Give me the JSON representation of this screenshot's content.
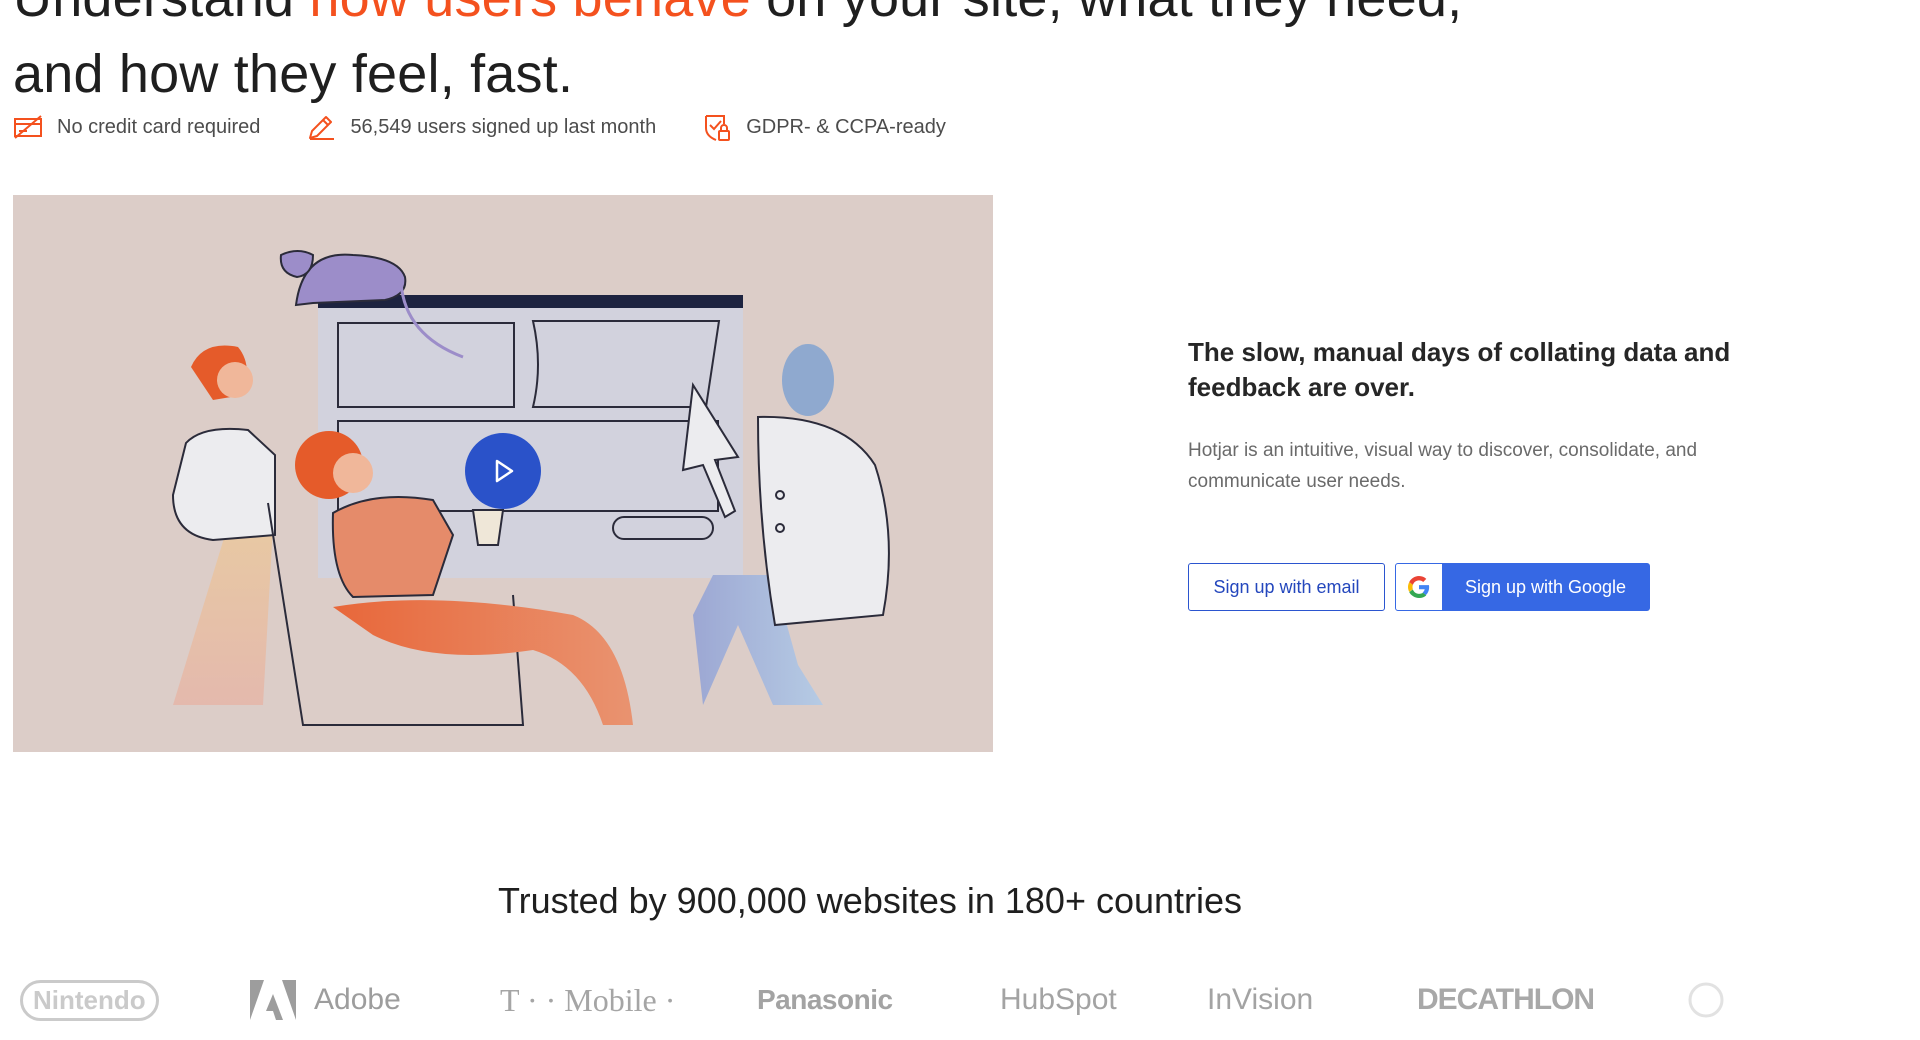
{
  "hero": {
    "title_prefix": "Understand ",
    "title_accent": "how users behave",
    "title_suffix": " on your site, what they need, and how they feel, fast."
  },
  "badges": [
    {
      "icon": "credit-card-icon",
      "label": "No credit card required"
    },
    {
      "icon": "pencil-icon",
      "label": "56,549 users signed up last month"
    },
    {
      "icon": "shield-lock-icon",
      "label": "GDPR- & CCPA-ready"
    }
  ],
  "video": {
    "play_icon": "play-icon"
  },
  "promo": {
    "heading": "The slow, manual days of collating data and feedback are over.",
    "text": "Hotjar is an intuitive, visual way to discover, consolidate, and communicate user needs.",
    "email_button": "Sign up with email",
    "google_button": "Sign up with Google"
  },
  "trusted": {
    "heading": "Trusted by 900,000 websites in 180+ countries",
    "logos": [
      "Nintendo",
      "Adobe",
      "T · · Mobile ·",
      "Panasonic",
      "HubSpot",
      "InVision",
      "DECATHLON"
    ]
  },
  "colors": {
    "accent": "#f4511e",
    "primary": "#3668e4",
    "media_bg": "#dccdc8"
  }
}
